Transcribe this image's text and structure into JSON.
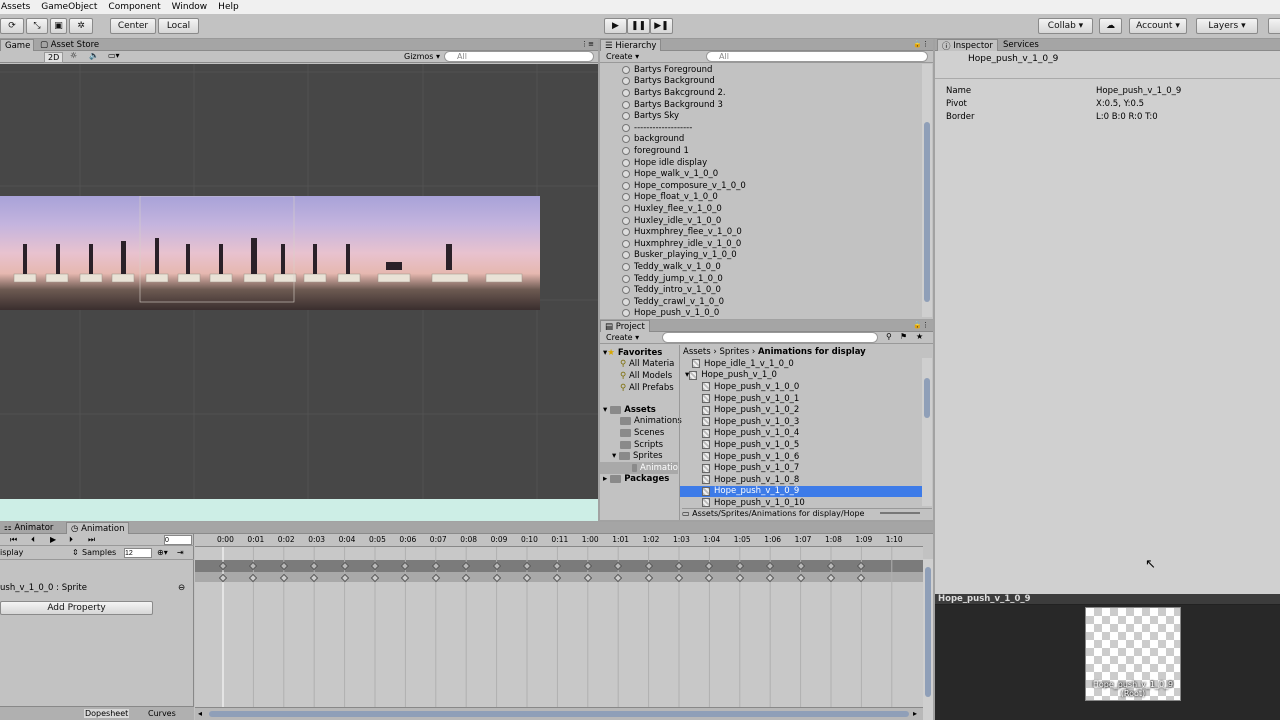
{
  "menu": [
    "Assets",
    "GameObject",
    "Component",
    "Window",
    "Help"
  ],
  "toolbar": {
    "pivot_center": "Center",
    "pivot_local": "Local",
    "collab": "Collab",
    "account": "Account",
    "layers": "Layers"
  },
  "game_tabs": {
    "game": "Game",
    "asset_store": "Asset Store",
    "mode_2d": "2D",
    "gizmos": "Gizmos",
    "search_placeholder": "All"
  },
  "hierarchy": {
    "title": "Hierarchy",
    "create": "Create",
    "search_placeholder": "All",
    "items": [
      "Bartys Foreground",
      "Bartys Background",
      "Bartys Bakcground 2.",
      "Bartys Background 3",
      "Bartys Sky",
      "-------------------",
      "background",
      "foreground 1",
      "Hope idle display",
      "Hope_walk_v_1_0_0",
      "Hope_composure_v_1_0_0",
      "Hope_float_v_1_0_0",
      "Huxley_flee_v_1_0_0",
      "Huxley_idle_v_1_0_0",
      "Huxmphrey_flee_v_1_0_0",
      "Huxmphrey_idle_v_1_0_0",
      "Busker_playing_v_1_0_0",
      "Teddy_walk_v_1_0_0",
      "Teddy_jump_v_1_0_0",
      "Teddy_intro_v_1_0_0",
      "Teddy_crawl_v_1_0_0",
      "Hope_push_v_1_0_0"
    ]
  },
  "project": {
    "title": "Project",
    "create": "Create",
    "breadcrumb": [
      "Assets",
      "Sprites",
      "Animations for display"
    ],
    "favorites_label": "Favorites",
    "favorites": [
      "All Materia",
      "All Models",
      "All Prefabs"
    ],
    "assets_label": "Assets",
    "assets": [
      "Animations",
      "Scenes",
      "Scripts",
      "Sprites",
      "Animatio"
    ],
    "packages_label": "Packages",
    "files": [
      "Hope_idle_1_v_1_0_0",
      "Hope_push_v_1_0",
      "Hope_push_v_1_0_0",
      "Hope_push_v_1_0_1",
      "Hope_push_v_1_0_2",
      "Hope_push_v_1_0_3",
      "Hope_push_v_1_0_4",
      "Hope_push_v_1_0_5",
      "Hope_push_v_1_0_6",
      "Hope_push_v_1_0_7",
      "Hope_push_v_1_0_8",
      "Hope_push_v_1_0_9",
      "Hope_push_v_1_0_10"
    ],
    "selected_index": 11,
    "path": "Assets/Sprites/Animations for display/Hope"
  },
  "inspector": {
    "tab_inspector": "Inspector",
    "tab_services": "Services",
    "title": "Hope_push_v_1_0_9",
    "fields": [
      {
        "label": "Name",
        "value": "Hope_push_v_1_0_9"
      },
      {
        "label": "Pivot",
        "value": "X:0.5, Y:0.5"
      },
      {
        "label": "Border",
        "value": "L:0 B:0 R:0 T:0"
      }
    ],
    "preview_title": "Hope_push_v_1_0_9",
    "preview_caption": "Hope_push_v_1_0_9",
    "preview_subcaption": "(Root)"
  },
  "animation": {
    "tab_animator": "Animator",
    "tab_animation": "Animation",
    "display_label": "isplay",
    "samples_label": "Samples",
    "samples_value": "12",
    "frame_value": "0",
    "property": "ush_v_1_0_0 : Sprite",
    "add_property": "Add Property",
    "dopesheet": "Dopesheet",
    "curves": "Curves",
    "ticks": [
      "0:00",
      "0:01",
      "0:02",
      "0:03",
      "0:04",
      "0:05",
      "0:06",
      "0:07",
      "0:08",
      "0:09",
      "0:10",
      "0:11",
      "1:00",
      "1:01",
      "1:02",
      "1:03",
      "1:04",
      "1:05",
      "1:06",
      "1:07",
      "1:08",
      "1:09",
      "1:10"
    ]
  }
}
